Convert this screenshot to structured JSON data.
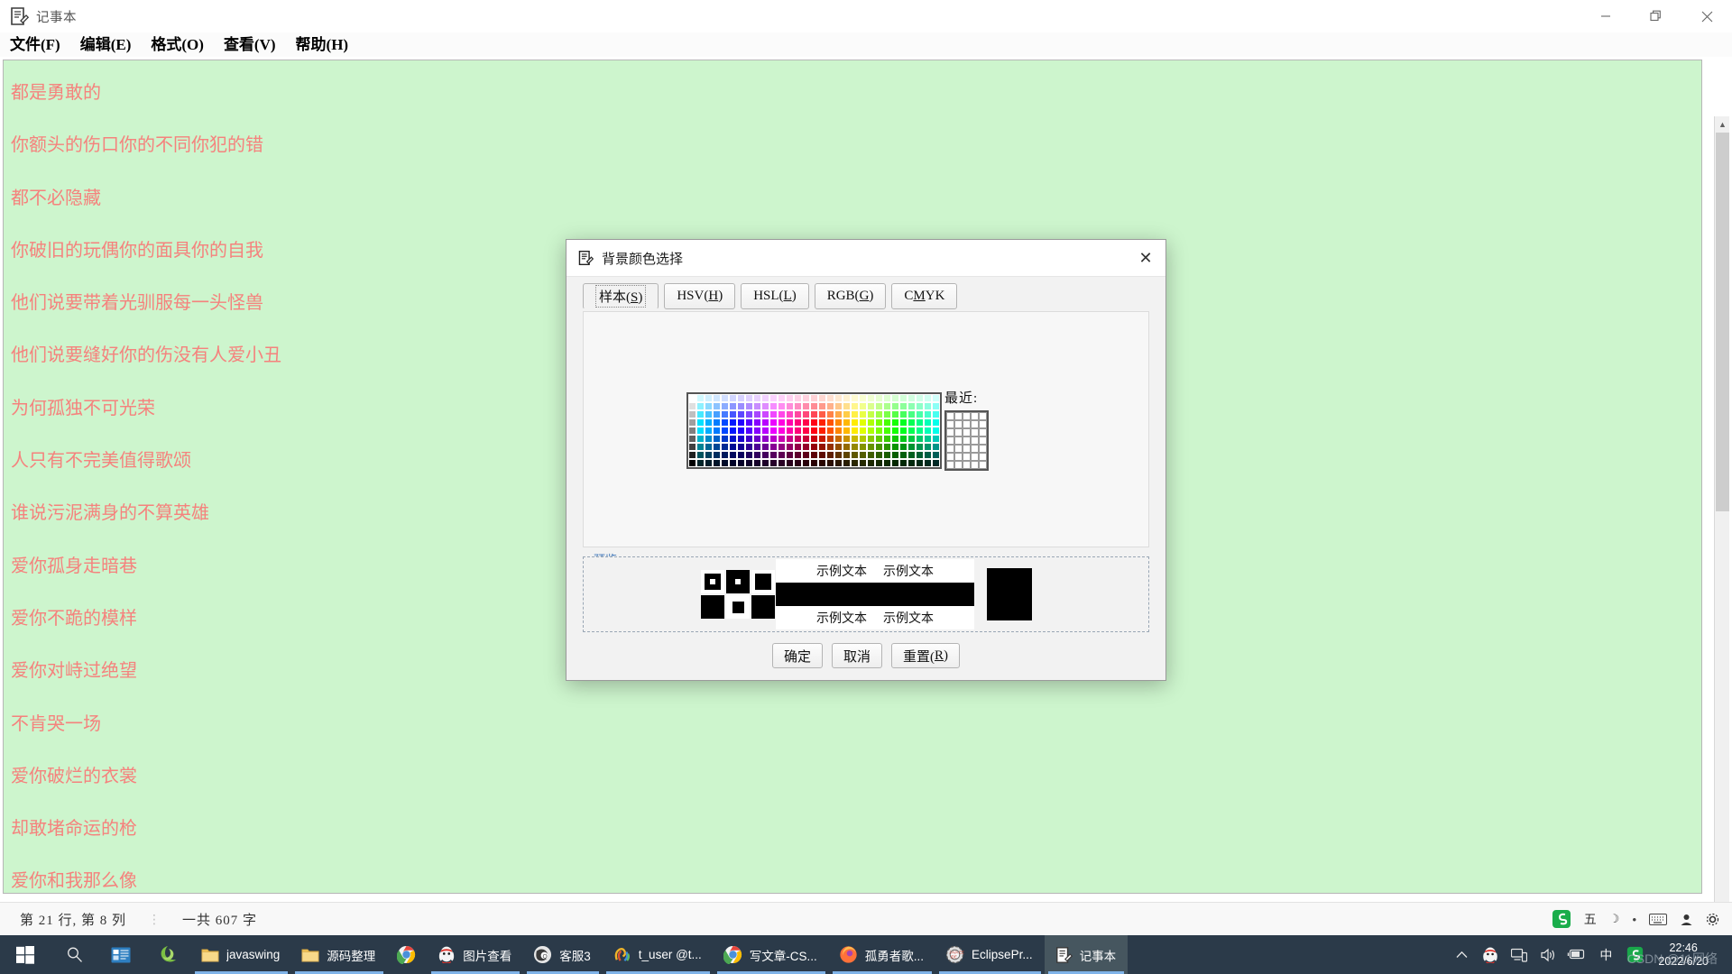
{
  "window": {
    "title": "记事本",
    "icon": "notepad-icon",
    "controls": {
      "minimize": "—",
      "maximize": "❐",
      "close": "✕"
    }
  },
  "menubar": {
    "items": [
      {
        "label": "文件(F)",
        "name": "menu-file"
      },
      {
        "label": "编辑(E)",
        "name": "menu-edit"
      },
      {
        "label": "格式(O)",
        "name": "menu-format"
      },
      {
        "label": "查看(V)",
        "name": "menu-view"
      },
      {
        "label": "帮助(H)",
        "name": "menu-help"
      }
    ]
  },
  "editor": {
    "background_color": "#cdf5cd",
    "text_color": "#f5827d",
    "lines": [
      "都是勇敢的",
      "",
      "你额头的伤口你的不同你犯的错",
      "",
      "都不必隐藏",
      "",
      "你破旧的玩偶你的面具你的自我",
      "",
      "他们说要带着光驯服每一头怪兽",
      "",
      "他们说要缝好你的伤没有人爱小丑",
      "",
      "为何孤独不可光荣",
      "",
      "人只有不完美值得歌颂",
      "",
      "谁说污泥满身的不算英雄",
      "",
      "爱你孤身走暗巷",
      "",
      "爱你不跪的模样",
      "",
      "爱你对峙过绝望",
      "",
      "不肯哭一场",
      "",
      "爱你破烂的衣裳",
      "",
      "却敢堵命运的枪",
      "",
      "爱你和我那么像"
    ]
  },
  "statusbar": {
    "position": "第 21 行, 第 8 列",
    "separator": "⋮",
    "count": "一共 607 字"
  },
  "dialog": {
    "title": "背景颜色选择",
    "icon": "notepad-icon",
    "close_label": "✕",
    "tabs": [
      {
        "label": "样本(S)",
        "pre": "样本(",
        "mnemonic": "S",
        "post": ")",
        "active": true
      },
      {
        "label": "HSV(H)",
        "pre": "HSV(",
        "mnemonic": "H",
        "post": ")",
        "active": false
      },
      {
        "label": "HSL(L)",
        "pre": "HSL(",
        "mnemonic": "L",
        "post": ")",
        "active": false
      },
      {
        "label": "RGB(G)",
        "pre": "RGB(",
        "mnemonic": "G",
        "post": ")",
        "active": false
      },
      {
        "label": "CMYK",
        "pre": "C",
        "mnemonic": "M",
        "post": "YK",
        "active": false
      }
    ],
    "recent_label": "最近:",
    "preview_label": "预览",
    "preview_sample_texts": [
      "示例文本",
      "示例文本",
      "示例文本",
      "示例文本"
    ],
    "buttons": [
      {
        "label": "确定",
        "pre": "确定",
        "mnemonic": "",
        "post": "",
        "name": "ok-button"
      },
      {
        "label": "取消",
        "pre": "取消",
        "mnemonic": "",
        "post": "",
        "name": "cancel-button"
      },
      {
        "label": "重置(R)",
        "pre": "重置(",
        "mnemonic": "R",
        "post": ")",
        "name": "reset-button"
      }
    ],
    "selected_color": "#000000"
  },
  "taskbar": {
    "start_label": "",
    "search_label": "",
    "items": [
      {
        "label": "javaswing",
        "icon": "folder-icon",
        "running": true,
        "active": false
      },
      {
        "label": "源码整理",
        "icon": "folder-icon",
        "running": true,
        "active": false
      },
      {
        "label": "",
        "icon": "chrome-icon",
        "running": false,
        "active": false
      },
      {
        "label": "图片查看",
        "icon": "qq-icon",
        "running": true,
        "active": false
      },
      {
        "label": "客服3",
        "icon": "qq-group-icon",
        "running": true,
        "active": false
      },
      {
        "label": "t_user @t...",
        "icon": "navicat-icon",
        "running": true,
        "active": false
      },
      {
        "label": "写文章-CS...",
        "icon": "chrome-icon",
        "running": true,
        "active": false
      },
      {
        "label": "孤勇者歌...",
        "icon": "firefox-icon",
        "running": true,
        "active": false
      },
      {
        "label": "EclipsePr...",
        "icon": "eclipse-icon",
        "running": true,
        "active": false
      },
      {
        "label": "记事本",
        "icon": "notepad-icon",
        "running": true,
        "active": true
      }
    ],
    "tray": {
      "icons": [
        "chevron-up-icon",
        "qq-icon",
        "network-icon",
        "volume-icon",
        "battery-icon",
        "ime-cn-icon",
        "sogou-icon"
      ],
      "ime_label": "中"
    },
    "clock": {
      "time": "22:46",
      "date": "2022/6/20"
    },
    "watermark": "CSDN @11网络"
  }
}
